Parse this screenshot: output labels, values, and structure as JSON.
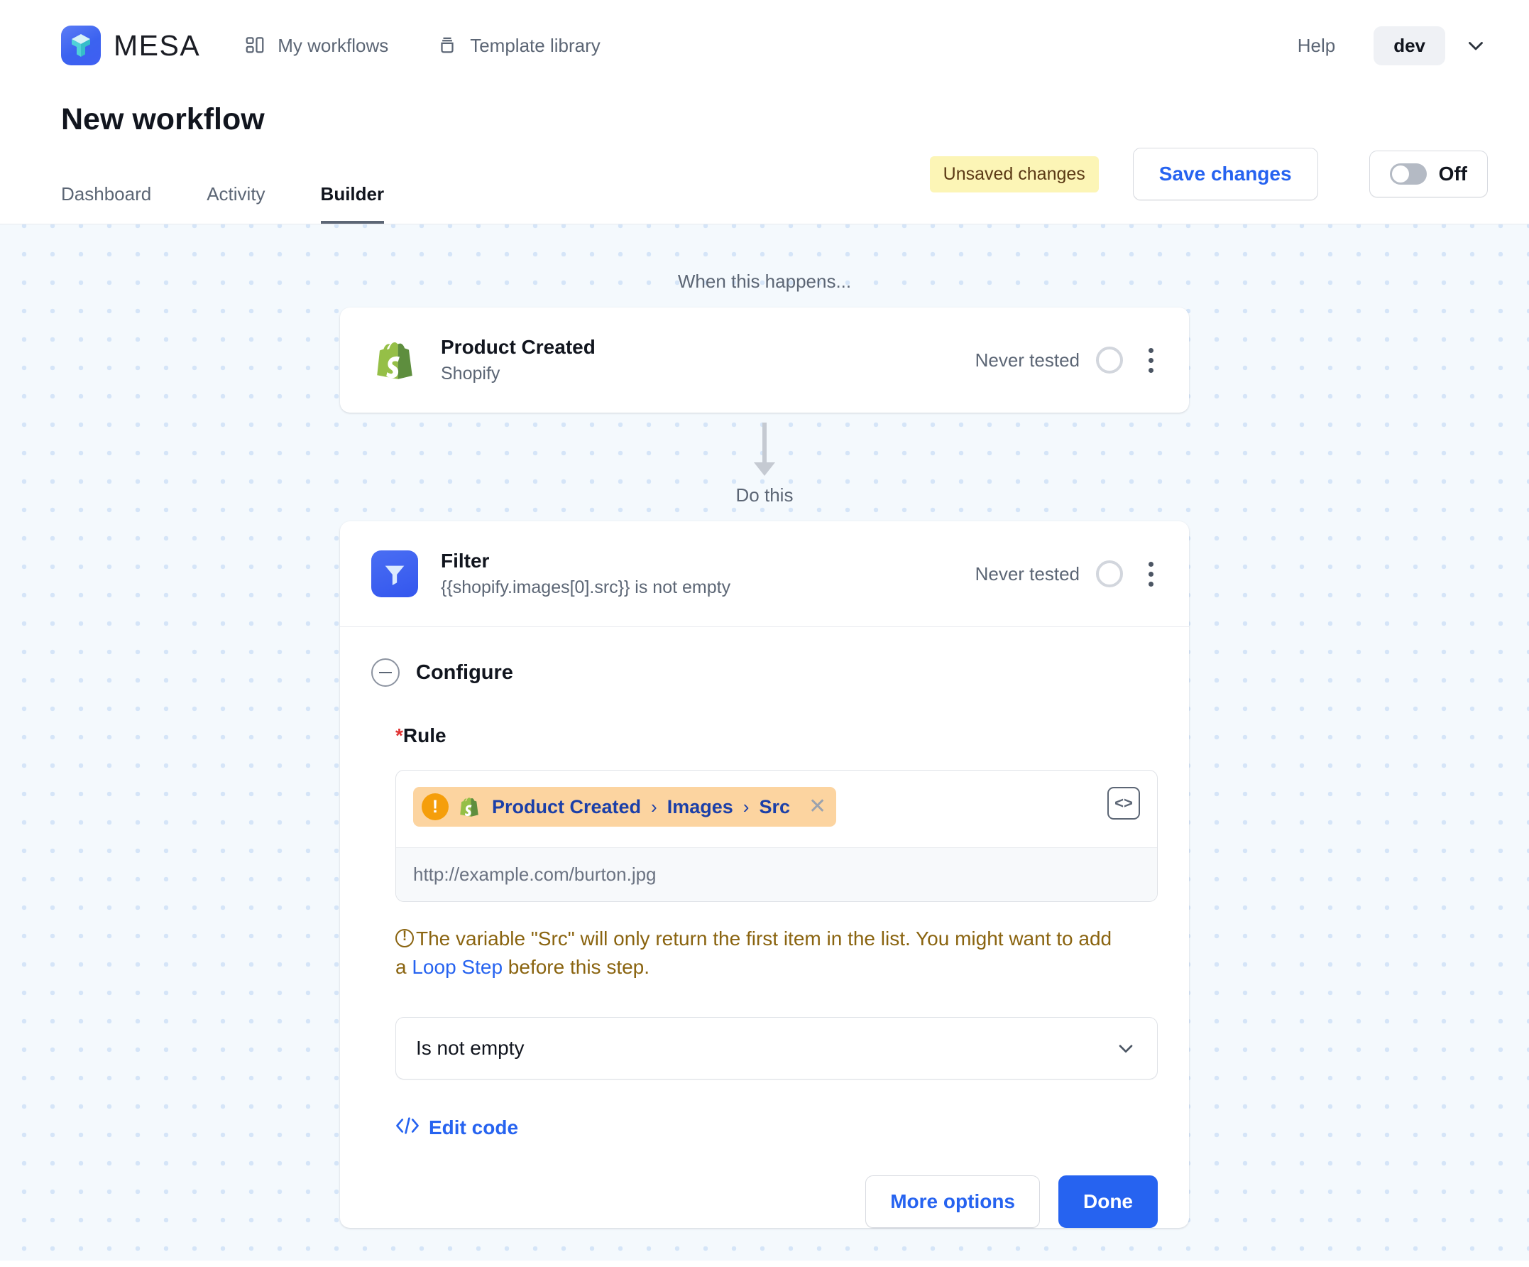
{
  "topnav": {
    "brand_name": "MESA",
    "logo_icon": "mesa-cube-logo",
    "links": [
      {
        "label": "My workflows",
        "icon": "layout-grid-icon"
      },
      {
        "label": "Template library",
        "icon": "library-stack-icon"
      }
    ],
    "help_label": "Help",
    "account_label": "dev",
    "account_caret_icon": "chevron-down-icon"
  },
  "header": {
    "page_title": "New workflow",
    "tabs": [
      {
        "label": "Dashboard",
        "active": false
      },
      {
        "label": "Activity",
        "active": false
      },
      {
        "label": "Builder",
        "active": true
      }
    ],
    "unsaved_badge": "Unsaved changes",
    "save_label": "Save changes",
    "toggle_label": "Off",
    "toggle_state": "off"
  },
  "canvas": {
    "trigger_label": "When this happens...",
    "action_label": "Do this",
    "arrow_icon": "arrow-down-icon"
  },
  "trigger_step": {
    "icon": "shopify-bag-icon",
    "title": "Product Created",
    "subtitle": "Shopify",
    "status": "Never tested",
    "status_ring_icon": "circle-empty-icon",
    "menu_icon": "kebab-menu-icon"
  },
  "action_step": {
    "icon": "filter-funnel-icon",
    "title": "Filter",
    "subtitle": "{{shopify.images[0].src}} is not empty",
    "status": "Never tested",
    "status_ring_icon": "circle-empty-icon",
    "menu_icon": "kebab-menu-icon"
  },
  "configure": {
    "section_title": "Configure",
    "collapse_icon": "minus-circle-icon",
    "rule_label": "Rule",
    "rule_required_marker": "*",
    "token": {
      "warning_icon": "exclamation-circle-icon",
      "source_icon": "shopify-bag-icon",
      "parts": [
        "Product Created",
        "Images",
        "Src"
      ],
      "separator": "›",
      "remove_icon": "close-x-icon"
    },
    "code_toggle_icon": "code-brackets-icon",
    "preview_value": "http://example.com/burton.jpg",
    "warning": {
      "icon": "info-exclamation-icon",
      "text_before": "The variable \"Src\" will only return the first item in the list. You might want to add a ",
      "link_text": "Loop Step",
      "text_after": " before this step."
    },
    "operator_value": "Is not empty",
    "operator_caret_icon": "chevron-down-icon",
    "edit_code_label": "Edit code",
    "edit_code_icon": "code-angle-brackets-icon",
    "more_options_label": "More options",
    "done_label": "Done"
  },
  "colors": {
    "accent_blue": "#2663f0",
    "canvas_bg": "#f4f9fd",
    "dot_color": "#d5e5f8",
    "token_bg": "#fcd4a0",
    "token_text": "#1b3fa8",
    "warning_text": "#8a6410",
    "unsaved_bg": "#fcf5b6",
    "shopify_green": "#95bf47"
  }
}
